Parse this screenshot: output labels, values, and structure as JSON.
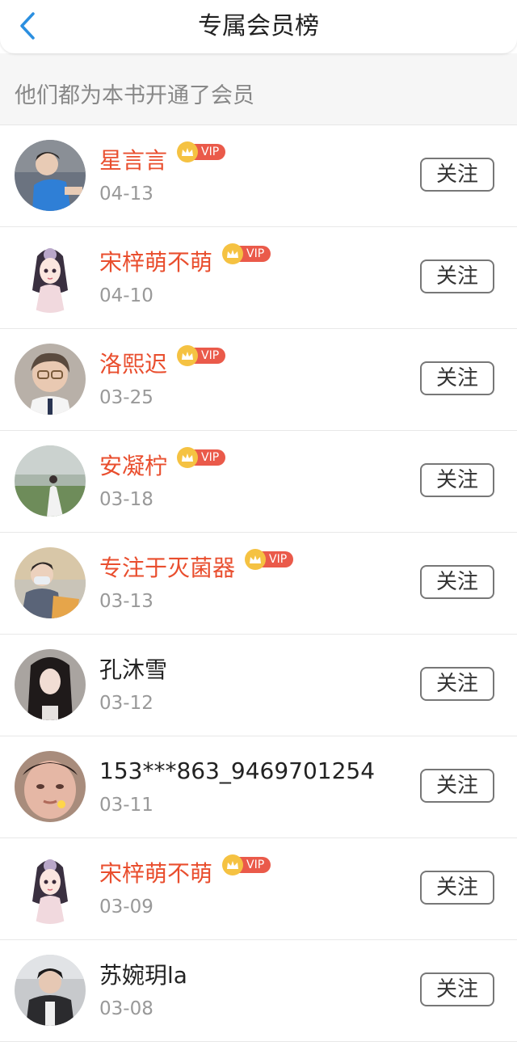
{
  "header": {
    "title": "专属会员榜",
    "back_icon": "chevron-left-icon"
  },
  "subtitle": "他们都为本书开通了会员",
  "colors": {
    "vip_name": "#e94e2e",
    "normal_name": "#222222",
    "back_icon": "#2b8fe0",
    "vip_badge": "#ea5a4a",
    "crown": "#f5c242"
  },
  "vip_label": "VIP",
  "follow_label": "关注",
  "members": [
    {
      "name": "星言言",
      "date": "04-13",
      "vip": true,
      "avatar": "avatar-boy-blue-shirt"
    },
    {
      "name": "宋梓萌不萌",
      "date": "04-10",
      "vip": true,
      "avatar": "avatar-anime-girl"
    },
    {
      "name": "洛熙迟",
      "date": "03-25",
      "vip": true,
      "avatar": "avatar-boy-glasses"
    },
    {
      "name": "安凝柠",
      "date": "03-18",
      "vip": true,
      "avatar": "avatar-girl-field"
    },
    {
      "name": "专注于灭菌器",
      "date": "03-13",
      "vip": true,
      "avatar": "avatar-boy-mask"
    },
    {
      "name": "孔沐雪",
      "date": "03-12",
      "vip": false,
      "avatar": "avatar-girl-dark-hair"
    },
    {
      "name": "153***863_9469701254",
      "date": "03-11",
      "vip": false,
      "avatar": "avatar-blurry-face"
    },
    {
      "name": "宋梓萌不萌",
      "date": "03-09",
      "vip": true,
      "avatar": "avatar-anime-girl"
    },
    {
      "name": "苏婉玥la",
      "date": "03-08",
      "vip": false,
      "avatar": "avatar-boy-dark"
    }
  ]
}
